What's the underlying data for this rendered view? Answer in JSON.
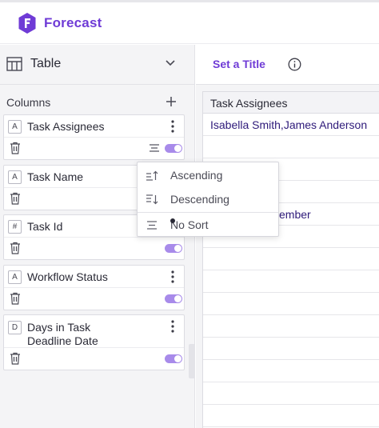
{
  "brand": {
    "name": "Forecast",
    "color": "#6f3bd6"
  },
  "left_panel": {
    "view_selector": {
      "label": "Table",
      "icon": "table-icon"
    },
    "columns_header": "Columns",
    "columns": [
      {
        "type": "A",
        "name": "Task Assignees",
        "enabled": true
      },
      {
        "type": "A",
        "name": "Task Name",
        "enabled": true
      },
      {
        "type": "#",
        "name": "Task Id",
        "enabled": true
      },
      {
        "type": "A",
        "name": "Workflow Status",
        "enabled": true
      },
      {
        "type": "D",
        "name": "Days in Task Deadline Date",
        "enabled": true
      }
    ]
  },
  "sort_menu": {
    "items": [
      "Ascending",
      "Descending",
      "No Sort"
    ],
    "selected": "No Sort"
  },
  "right_panel": {
    "title_button": "Set a Title",
    "table": {
      "header": "Task Assignees",
      "rows": [
        "Isabella Smith,James Anderson",
        "",
        "",
        "",
        "ember"
      ]
    }
  },
  "colors": {
    "accent": "#6f3bd6",
    "toggle_on": "#a88bea"
  }
}
